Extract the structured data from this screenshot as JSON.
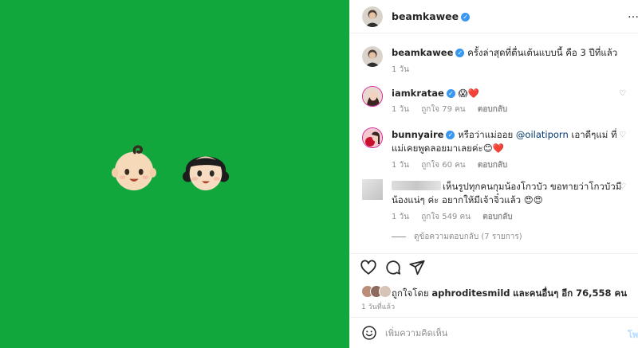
{
  "header": {
    "username": "beamkawee",
    "more_label": "…"
  },
  "caption": {
    "username": "beamkawee",
    "text": "ครั้งล่าสุดที่ตื่นเต้นแบบนี้ คือ 3 ปีที่แล้ว",
    "time": "1 วัน"
  },
  "comments": [
    {
      "username": "iamkratae",
      "text_suffix": "😱❤️",
      "time": "1 วัน",
      "likes": "ถูกใจ 79 คน",
      "reply": "ตอบกลับ"
    },
    {
      "username": "bunnyaire",
      "text_pre": "หรือว่าแม่ออย",
      "mention": "@oilatiporn",
      "text_post": "เอาดีๆแม่ ที่แม่เคยพูดลอยมาเลยค่ะ😊❤️",
      "time": "1 วัน",
      "likes": "ถูกใจ 60 คน",
      "reply": "ตอบกลับ"
    },
    {
      "username": "",
      "text": "เห็นรูปทุกคนกุมน้องโกวบัว ขอทายว่าโกวบัวมีน้องแน่ๆ ค่ะ อยากให้มีเจ้าจิ๋วแล้ว 😍😍",
      "time": "1 วัน",
      "likes": "ถูกใจ 549 คน",
      "reply": "ตอบกลับ"
    }
  ],
  "view_replies": "ดูข้อความตอบกลับ (7 รายการ)",
  "likes": {
    "prefix": "ถูกใจโดย",
    "user": "aphroditesmild",
    "suffix": "และคนอื่นๆ อีก 76,558 คน"
  },
  "posted_ago": "1 วันที่แล้ว",
  "add_comment": {
    "placeholder": "เพิ่มความคิดเห็น",
    "post_label": "โพ"
  },
  "colors": {
    "media_bg": "#12a73d",
    "verified": "#3897f0",
    "link": "#00376b"
  }
}
